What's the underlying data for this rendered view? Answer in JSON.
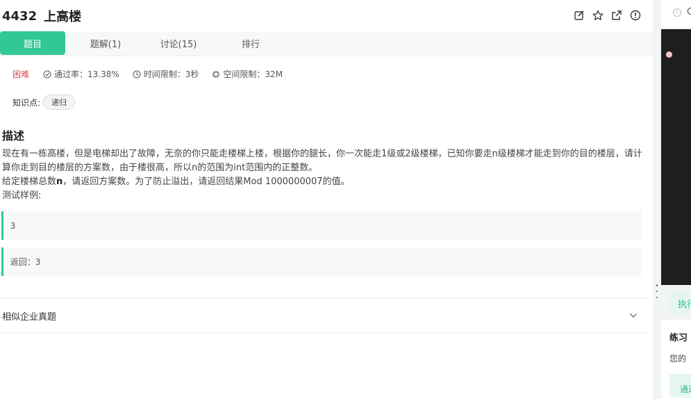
{
  "problem": {
    "number": "4432",
    "title": "上高楼"
  },
  "tabs": [
    {
      "label": "题目",
      "active": true
    },
    {
      "label": "题解(1)",
      "active": false
    },
    {
      "label": "讨论(15)",
      "active": false
    },
    {
      "label": "排行",
      "active": false
    }
  ],
  "meta": {
    "difficulty": "困难",
    "pass_rate": "通过率：13.38%",
    "time_limit": "时间限制：3秒",
    "space_limit": "空间限制：32M"
  },
  "knowledge": {
    "label": "知识点:",
    "tags": [
      "递归"
    ]
  },
  "description": {
    "heading": "描述",
    "para1": "现在有一栋高楼，但是电梯却出了故障，无奈的你只能走楼梯上楼，根据你的腿长，你一次能走1级或2级楼梯，已知你要走n级楼梯才能走到你的目的楼层，请计算你走到目的楼层的方案数，由于楼很高，所以n的范围为int范围内的正整数。",
    "para2_pre": "给定楼梯总数",
    "para2_bold": "n",
    "para2_post": "，请返回方案数。为了防止溢出，请返回结果Mod 1000000007的值。",
    "example_label": "测试样例:",
    "input": "3",
    "output": "返回：3"
  },
  "similar": {
    "label": "相似企业真题"
  },
  "right_panel": {
    "top_char": "C",
    "execute_label": "执行",
    "practice_heading": "练习",
    "practice_text": "您的",
    "submit_label": "通过"
  },
  "colors": {
    "accent": "#32c896",
    "difficulty": "#e04b4b",
    "editor_bg": "#1e1e1e"
  },
  "icons": [
    "edit-icon",
    "star-icon",
    "share-icon",
    "info-icon",
    "check-circle-icon",
    "clock-icon",
    "memory-icon",
    "chevron-down-icon"
  ]
}
